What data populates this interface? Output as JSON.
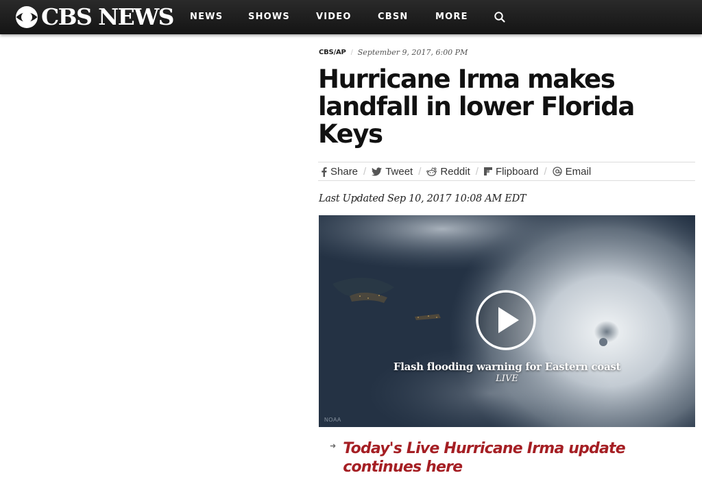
{
  "header": {
    "logo_text": "CBS NEWS",
    "nav": [
      "NEWS",
      "SHOWS",
      "VIDEO",
      "CBSN",
      "MORE"
    ],
    "search_icon": "search-icon"
  },
  "article": {
    "source": "CBS/AP",
    "separator": "/",
    "date": "September 9, 2017, 6:00 PM",
    "headline": "Hurricane Irma makes landfall in lower Florida Keys",
    "share": [
      {
        "icon": "facebook-icon",
        "label": "Share"
      },
      {
        "icon": "twitter-icon",
        "label": "Tweet"
      },
      {
        "icon": "reddit-icon",
        "label": "Reddit"
      },
      {
        "icon": "flipboard-icon",
        "label": "Flipboard"
      },
      {
        "icon": "email-icon",
        "label": "Email"
      }
    ],
    "updated": "Last Updated Sep 10, 2017 10:08 AM EDT"
  },
  "video": {
    "title": "Flash flooding warning for Eastern coast",
    "status": "LIVE",
    "credit": "NOAA",
    "play_icon": "play-icon"
  },
  "live_update": {
    "text": "Today's Live Hurricane Irma update continues here",
    "arrow_icon": "arrow-right-icon"
  },
  "colors": {
    "nav_bg": "#1a1a1a",
    "link_red": "#a51f24"
  }
}
